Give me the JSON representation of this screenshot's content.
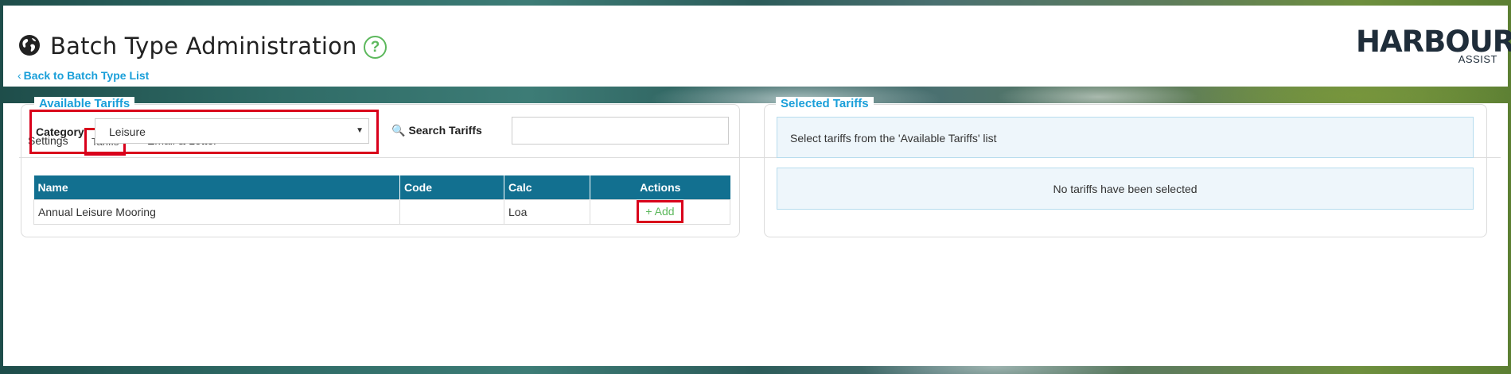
{
  "header": {
    "title": "Batch Type Administration",
    "help_glyph": "?",
    "back_link": "Back to Batch Type List",
    "logo_main": "HARBOUR",
    "logo_sub": "ASSIST"
  },
  "tabs": [
    {
      "label": "Settings"
    },
    {
      "label": "Tariffs"
    },
    {
      "label": "Email & Letter"
    }
  ],
  "available": {
    "legend": "Available Tariffs",
    "category_label": "Category",
    "category_value": "Leisure",
    "search_label": "Search Tariffs",
    "search_value": "",
    "columns": [
      "Name",
      "Code",
      "Calc",
      "Actions"
    ],
    "rows": [
      {
        "name": "Annual Leisure Mooring",
        "code": "",
        "calc": "Loa",
        "action": "+ Add"
      }
    ]
  },
  "selected": {
    "legend": "Selected Tariffs",
    "info": "Select tariffs from the 'Available Tariffs' list",
    "empty": "No tariffs have been selected"
  },
  "icons": {
    "globe": "globe-icon",
    "help": "help-circle-icon",
    "back": "chevron-left-icon",
    "search": "magnifier-icon",
    "dropdown": "caret-down-icon"
  },
  "colors": {
    "accent_blue": "#1a9fd9",
    "table_header": "#127090",
    "highlight_red": "#d9001b",
    "success_green": "#5cb85c",
    "info_bg": "#eef6fb"
  }
}
